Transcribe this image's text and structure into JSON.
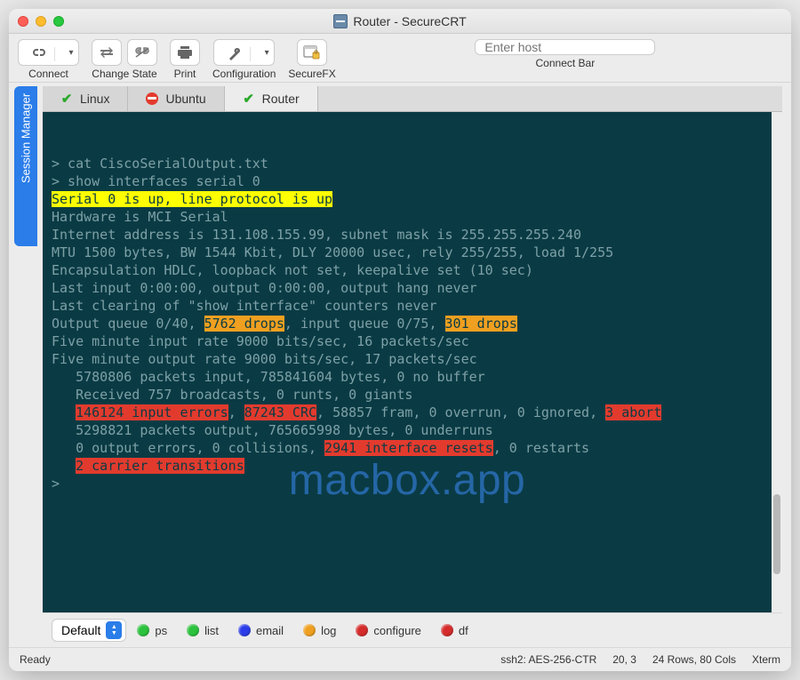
{
  "window": {
    "title": "Router - SecureCRT"
  },
  "toolbar": {
    "connect": "Connect",
    "change_state": "Change State",
    "print": "Print",
    "configuration": "Configuration",
    "securefx": "SecureFX",
    "connect_bar": "Connect Bar",
    "enter_host_placeholder": "Enter host"
  },
  "session_manager_label": "Session Manager",
  "tabs": [
    {
      "label": "Linux",
      "status": "ok"
    },
    {
      "label": "Ubuntu",
      "status": "error"
    },
    {
      "label": "Router",
      "status": "ok",
      "active": true
    }
  ],
  "terminal": {
    "lines": [
      {
        "segs": [
          {
            "t": "> cat CiscoSerialOutput.txt"
          }
        ]
      },
      {
        "segs": [
          {
            "t": "> show interfaces serial 0"
          }
        ]
      },
      {
        "segs": [
          {
            "t": "Serial 0 is up, line protocol is up",
            "cls": "hl-yellow"
          }
        ]
      },
      {
        "segs": [
          {
            "t": "Hardware is MCI Serial"
          }
        ]
      },
      {
        "segs": [
          {
            "t": "Internet address is 131.108.155.99, subnet mask is 255.255.255.240"
          }
        ]
      },
      {
        "segs": [
          {
            "t": "MTU 1500 bytes, BW 1544 Kbit, DLY 20000 usec, rely 255/255, load 1/255"
          }
        ]
      },
      {
        "segs": [
          {
            "t": "Encapsulation HDLC, loopback not set, keepalive set (10 sec)"
          }
        ]
      },
      {
        "segs": [
          {
            "t": "Last input 0:00:00, output 0:00:00, output hang never"
          }
        ]
      },
      {
        "segs": [
          {
            "t": "Last clearing of \"show interface\" counters never"
          }
        ]
      },
      {
        "segs": [
          {
            "t": "Output queue 0/40, "
          },
          {
            "t": "5762 drops",
            "cls": "hl-orange"
          },
          {
            "t": ", input queue 0/75, "
          },
          {
            "t": "301 drops",
            "cls": "hl-orange"
          }
        ]
      },
      {
        "segs": [
          {
            "t": "Five minute input rate 9000 bits/sec, 16 packets/sec"
          }
        ]
      },
      {
        "segs": [
          {
            "t": "Five minute output rate 9000 bits/sec, 17 packets/sec"
          }
        ]
      },
      {
        "segs": [
          {
            "t": "   5780806 packets input, 785841604 bytes, 0 no buffer"
          }
        ]
      },
      {
        "segs": [
          {
            "t": "   Received 757 broadcasts, 0 runts, 0 giants"
          }
        ]
      },
      {
        "segs": [
          {
            "t": "   "
          },
          {
            "t": "146124 input errors",
            "cls": "hl-red"
          },
          {
            "t": ", "
          },
          {
            "t": "87243 CRC",
            "cls": "hl-red"
          },
          {
            "t": ", 58857 fram, 0 overrun, 0 ignored, "
          },
          {
            "t": "3 abort",
            "cls": "hl-red"
          }
        ]
      },
      {
        "segs": [
          {
            "t": "   5298821 packets output, 765665998 bytes, 0 underruns"
          }
        ]
      },
      {
        "segs": [
          {
            "t": "   0 output errors, 0 collisions, "
          },
          {
            "t": "2941 interface resets",
            "cls": "hl-red"
          },
          {
            "t": ", 0 restarts"
          }
        ]
      },
      {
        "segs": [
          {
            "t": "   "
          },
          {
            "t": "2 carrier transitions",
            "cls": "hl-red"
          }
        ]
      },
      {
        "segs": [
          {
            "t": ""
          }
        ]
      },
      {
        "segs": [
          {
            "t": ">"
          }
        ]
      }
    ]
  },
  "watermark": "macbox.app",
  "bottombar": {
    "keyword_select": "Default",
    "buttons": [
      {
        "label": "ps",
        "color": "#2bc23d"
      },
      {
        "label": "list",
        "color": "#2bc23d"
      },
      {
        "label": "email",
        "color": "#2b3de9"
      },
      {
        "label": "log",
        "color": "#f0a020"
      },
      {
        "label": "configure",
        "color": "#d52b2b"
      },
      {
        "label": "df",
        "color": "#d52b2b"
      }
    ]
  },
  "status": {
    "left": "Ready",
    "protocol": "ssh2: AES-256-CTR",
    "cursor": "20,  3",
    "size": "24 Rows, 80 Cols",
    "term": "Xterm"
  }
}
